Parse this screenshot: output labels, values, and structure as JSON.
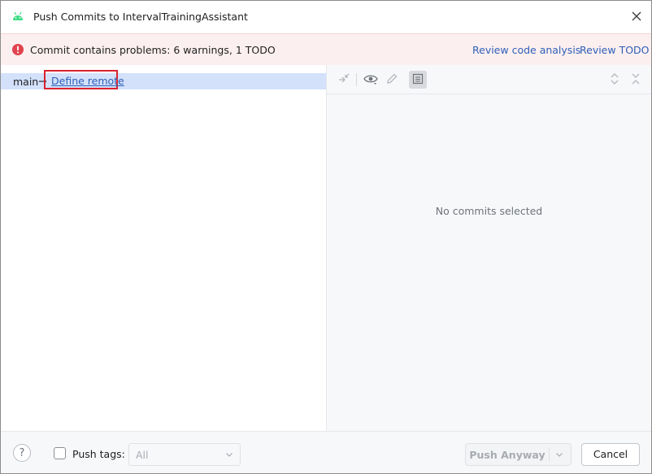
{
  "window": {
    "title": "Push Commits to IntervalTrainingAssistant",
    "app_icon": "android-icon",
    "close_icon": "close-icon"
  },
  "banner": {
    "icon": "error-icon",
    "message": "Commit contains problems: 6 warnings, 1 TODO",
    "link_code_analysis": "Review code analysis",
    "link_todo": "Review TODO"
  },
  "branch": {
    "name": "main",
    "arrow": "→",
    "remote_link": "Define remote"
  },
  "details": {
    "empty_text": "No commits selected",
    "toolbar_icons": [
      "merge-arrows-icon",
      "eye-icon",
      "edit-icon",
      "details-panel-icon",
      "expand-all-icon",
      "collapse-all-icon"
    ]
  },
  "footer": {
    "help_glyph": "?",
    "push_tags_label": "Push tags:",
    "push_tags_checked": false,
    "tags_select_value": "All",
    "push_button": "Push Anyway",
    "cancel_button": "Cancel"
  },
  "colors": {
    "banner_bg": "#fcefef",
    "error_red": "#e0434e",
    "link_blue": "#2e5fb8",
    "selection_bg": "#d3e1fb",
    "highlight_box": "#d9232e"
  }
}
